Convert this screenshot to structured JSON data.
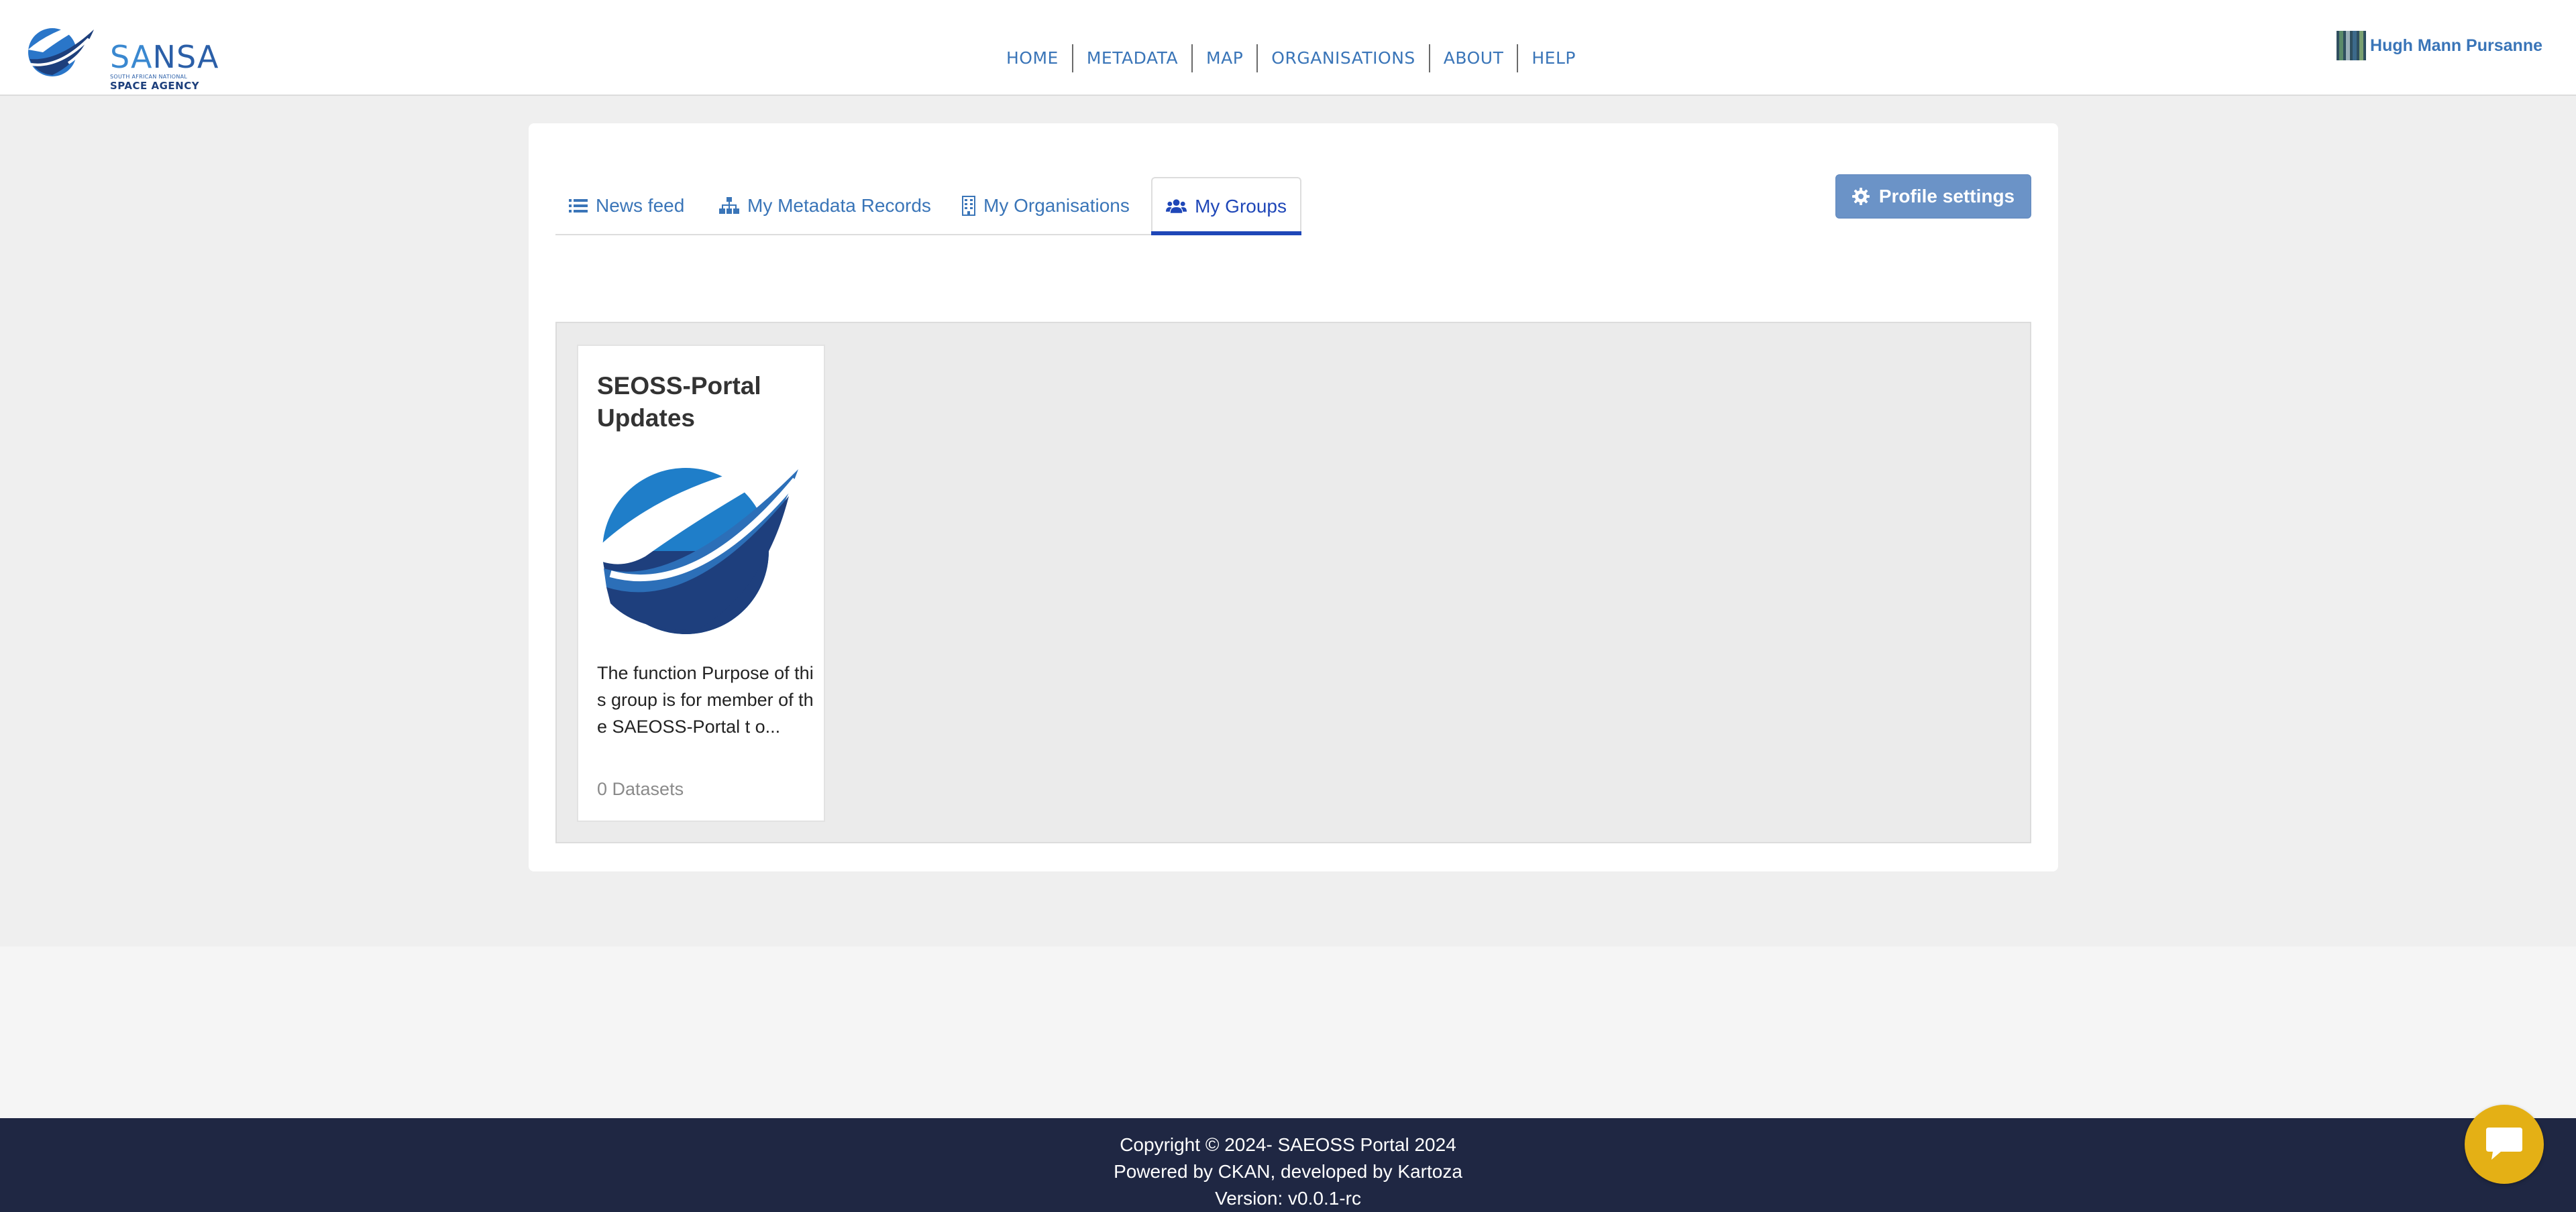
{
  "brand": {
    "logo_word_sa": "SA",
    "logo_word_nsa": "NSA",
    "logo_sub1": "SOUTH AFRICAN NATIONAL",
    "logo_sub2": "SPACE AGENCY"
  },
  "nav": {
    "items": [
      {
        "label": "HOME"
      },
      {
        "label": "METADATA"
      },
      {
        "label": "MAP"
      },
      {
        "label": "ORGANISATIONS"
      },
      {
        "label": "ABOUT"
      },
      {
        "label": "HELP"
      }
    ]
  },
  "user": {
    "name": "Hugh Mann Pursanne",
    "avatar_icon": "user-avatar-image"
  },
  "tabs": [
    {
      "label": "News feed",
      "icon": "list-icon",
      "active": false
    },
    {
      "label": "My Metadata Records",
      "icon": "sitemap-icon",
      "active": false
    },
    {
      "label": "My Organisations",
      "icon": "building-icon",
      "active": false
    },
    {
      "label": "My Groups",
      "icon": "users-icon",
      "active": true
    }
  ],
  "profile_button": {
    "label": "Profile settings",
    "icon": "gear-icon"
  },
  "groups": [
    {
      "title": "SEOSS-Portal Updates",
      "description": "The function Purpose of this group is for member of the SAEOSS-Portal t o...",
      "datasets": "0 Datasets"
    }
  ],
  "footer": {
    "copyright": "Copyright © 2024- SAEOSS Portal 2024",
    "powered_by": "Powered by CKAN, developed by Kartoza",
    "version": "Version: v0.0.1-rc"
  },
  "colors": {
    "accent": "#3a75b8",
    "active_tab": "#1f47b8",
    "button": "#6b93c7",
    "footer_bg": "#1f2743",
    "chat_button": "#e4b015"
  }
}
